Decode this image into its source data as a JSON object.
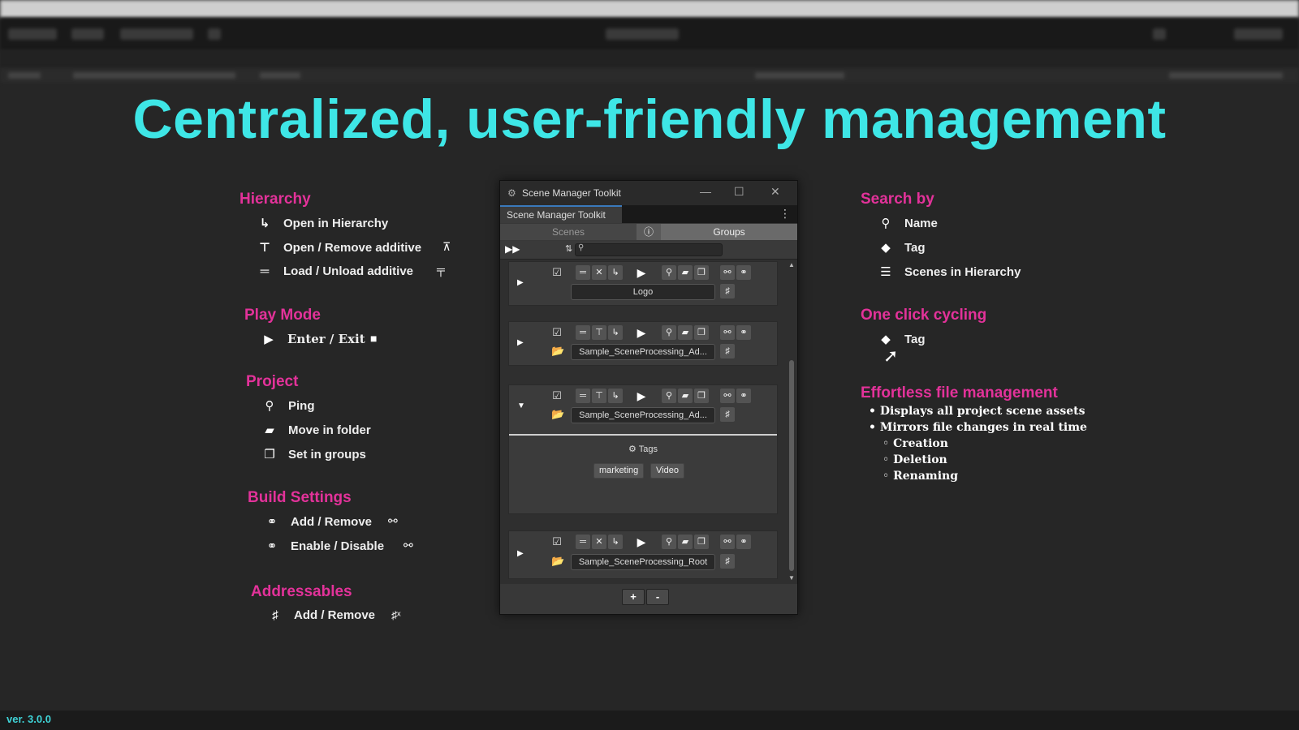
{
  "headline": "Centralized, user-friendly management",
  "version": "ver. 3.0.0",
  "left": {
    "hierarchy": {
      "title": "Hierarchy",
      "open": "Open in Hierarchy",
      "open_remove": "Open / Remove additive",
      "load_unload": "Load / Unload additive"
    },
    "playmode": {
      "title": "Play Mode",
      "enter_exit": "Enter / Exit"
    },
    "project": {
      "title": "Project",
      "ping": "Ping",
      "move": "Move in folder",
      "groups": "Set in groups"
    },
    "build": {
      "title": "Build Settings",
      "add_remove": "Add / Remove",
      "enable_disable": "Enable / Disable"
    },
    "addressables": {
      "title": "Addressables",
      "add_remove": "Add / Remove"
    }
  },
  "right": {
    "search": {
      "title": "Search by",
      "name": "Name",
      "tag": "Tag",
      "scenes": "Scenes in Hierarchy"
    },
    "cycling": {
      "title": "One click cycling",
      "tag": "Tag"
    },
    "files": {
      "title": "Effortless file management",
      "b1": "• Displays all project scene assets",
      "b2": "• Mirrors file changes in real time",
      "s1": "◦ Creation",
      "s2": "◦ Deletion",
      "s3": "◦ Renaming"
    }
  },
  "window": {
    "title": "Scene Manager Toolkit",
    "tab": "Scene Manager Toolkit",
    "seg_scenes": "Scenes",
    "seg_groups": "Groups",
    "cards": [
      {
        "name": "Logo"
      },
      {
        "name": "Sample_SceneProcessing_Ad..."
      },
      {
        "name": "Sample_SceneProcessing_Ad...",
        "tags_label": "Tags",
        "tags": [
          "marketing",
          "Video"
        ]
      },
      {
        "name": "Sample_SceneProcessing_Root"
      }
    ],
    "plus": "+",
    "minus": "-"
  },
  "colors": {
    "accent_cyan": "#3ee6e6",
    "section_pink": "#e3329a",
    "folder": "#e8a93a"
  }
}
